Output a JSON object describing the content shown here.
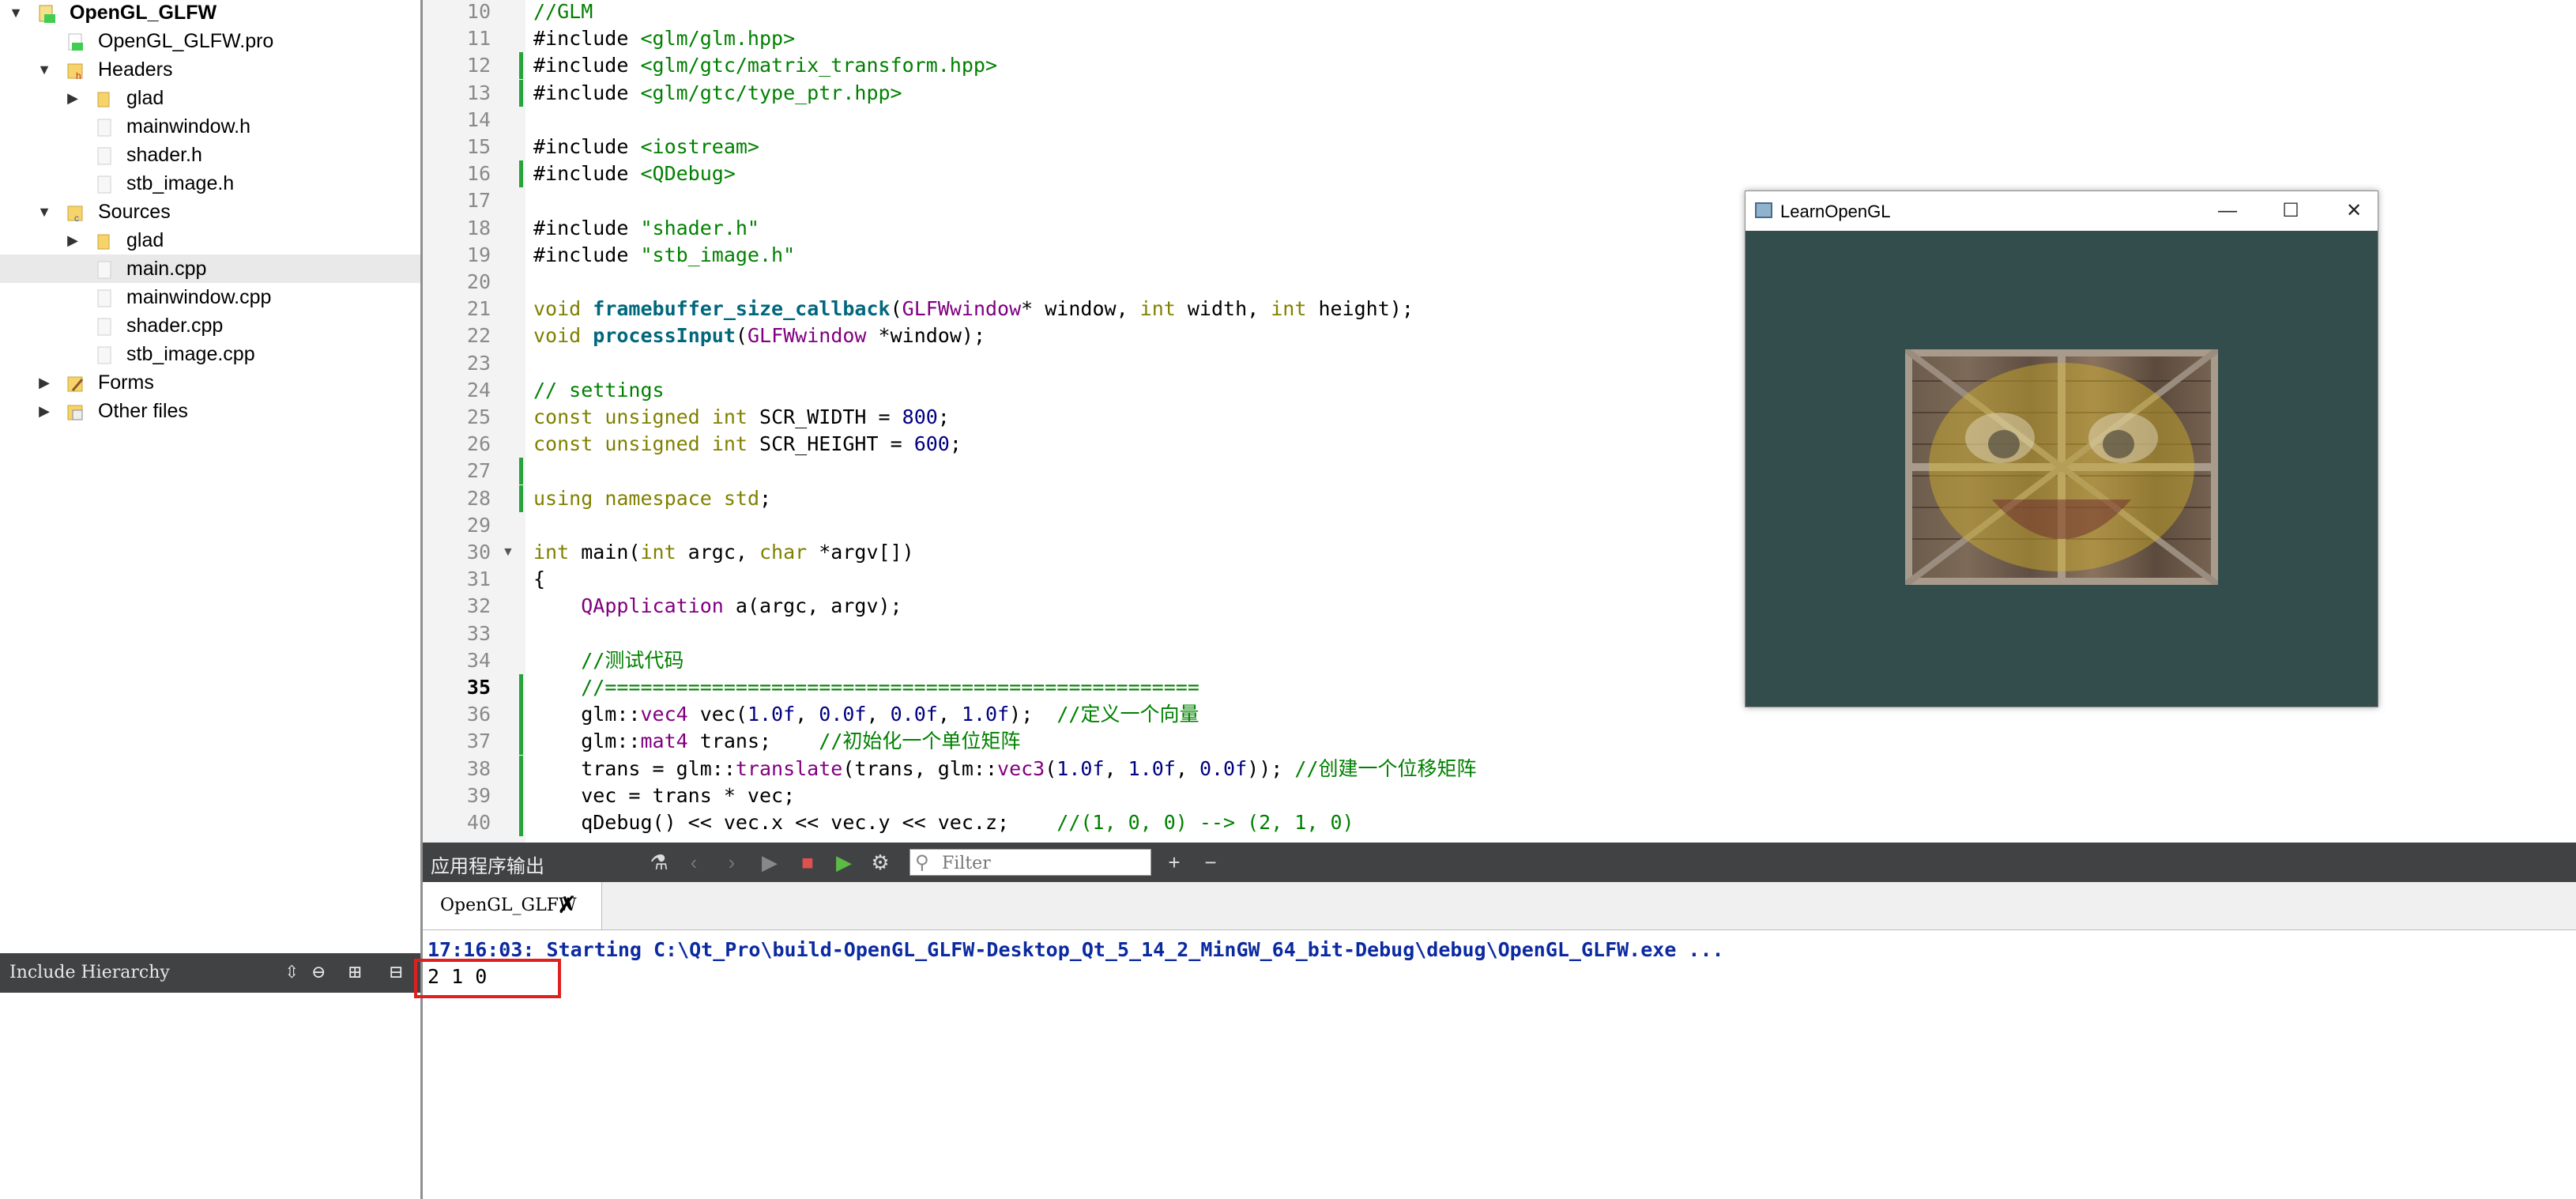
{
  "project_tree": {
    "items": [
      {
        "label": "OpenGL_GLFW",
        "arrow": "▼",
        "icon": "project-icon",
        "bold": true
      },
      {
        "label": "OpenGL_GLFW.pro",
        "arrow": "",
        "icon": "pro-file-icon"
      },
      {
        "label": "Headers",
        "arrow": "▼",
        "icon": "headers-folder-icon"
      },
      {
        "label": "glad",
        "arrow": "▶",
        "icon": "folder-icon"
      },
      {
        "label": "mainwindow.h",
        "arrow": "",
        "icon": "file-icon"
      },
      {
        "label": "shader.h",
        "arrow": "",
        "icon": "file-icon"
      },
      {
        "label": "stb_image.h",
        "arrow": "",
        "icon": "file-icon"
      },
      {
        "label": "Sources",
        "arrow": "▼",
        "icon": "sources-folder-icon"
      },
      {
        "label": "glad",
        "arrow": "▶",
        "icon": "folder-icon"
      },
      {
        "label": "main.cpp",
        "arrow": "",
        "icon": "file-icon",
        "selected": true
      },
      {
        "label": "mainwindow.cpp",
        "arrow": "",
        "icon": "file-icon"
      },
      {
        "label": "shader.cpp",
        "arrow": "",
        "icon": "file-icon"
      },
      {
        "label": "stb_image.cpp",
        "arrow": "",
        "icon": "file-icon"
      },
      {
        "label": "Forms",
        "arrow": "▶",
        "icon": "forms-folder-icon"
      },
      {
        "label": "Other files",
        "arrow": "▶",
        "icon": "other-files-icon"
      }
    ]
  },
  "include_hierarchy": {
    "label": "Include Hierarchy"
  },
  "editor": {
    "current_line": 35,
    "lines": [
      {
        "n": "10",
        "text": "//GLM"
      },
      {
        "n": "11",
        "text": "#include <glm/glm.hpp>"
      },
      {
        "n": "12",
        "text": "#include <glm/gtc/matrix_transform.hpp>"
      },
      {
        "n": "13",
        "text": "#include <glm/gtc/type_ptr.hpp>"
      },
      {
        "n": "14",
        "text": ""
      },
      {
        "n": "15",
        "text": "#include <iostream>"
      },
      {
        "n": "16",
        "text": "#include <QDebug>"
      },
      {
        "n": "17",
        "text": ""
      },
      {
        "n": "18",
        "text": "#include \"shader.h\""
      },
      {
        "n": "19",
        "text": "#include \"stb_image.h\""
      },
      {
        "n": "20",
        "text": ""
      },
      {
        "n": "21",
        "text": "void framebuffer_size_callback(GLFWwindow* window, int width, int height);"
      },
      {
        "n": "22",
        "text": "void processInput(GLFWwindow *window);"
      },
      {
        "n": "23",
        "text": ""
      },
      {
        "n": "24",
        "text": "// settings"
      },
      {
        "n": "25",
        "text": "const unsigned int SCR_WIDTH = 800;"
      },
      {
        "n": "26",
        "text": "const unsigned int SCR_HEIGHT = 600;"
      },
      {
        "n": "27",
        "text": ""
      },
      {
        "n": "28",
        "text": "using namespace std;"
      },
      {
        "n": "29",
        "text": ""
      },
      {
        "n": "30",
        "text": "int main(int argc, char *argv[])"
      },
      {
        "n": "31",
        "text": "{"
      },
      {
        "n": "32",
        "text": "    QApplication a(argc, argv);"
      },
      {
        "n": "33",
        "text": ""
      },
      {
        "n": "34",
        "text": "    //测试代码"
      },
      {
        "n": "35",
        "text": "    //=================================================="
      },
      {
        "n": "36",
        "text": "    glm::vec4 vec(1.0f, 0.0f, 0.0f, 1.0f);  //定义一个向量"
      },
      {
        "n": "37",
        "text": "    glm::mat4 trans;    //初始化一个单位矩阵"
      },
      {
        "n": "38",
        "text": "    trans = glm::translate(trans, glm::vec3(1.0f, 1.0f, 0.0f)); //创建一个位移矩阵"
      },
      {
        "n": "39",
        "text": "    vec = trans * vec;"
      },
      {
        "n": "40",
        "text": "    qDebug() << vec.x << vec.y << vec.z;    //(1, 0, 0) --> (2, 1, 0)"
      }
    ]
  },
  "gl_window": {
    "title": "LearnOpenGL",
    "minimize": "—",
    "maximize": "☐",
    "close": "✕",
    "clear_color": "#334d4d"
  },
  "output_pane": {
    "title": "应用程序输出",
    "filter_placeholder": "Filter",
    "tab_label": "OpenGL_GLFW",
    "start_line": "17:16:03: Starting C:\\Qt_Pro\\build-OpenGL_GLFW-Desktop_Qt_5_14_2_MinGW_64_bit-Debug\\debug\\OpenGL_GLFW.exe ...",
    "result_line": "2 1 0"
  },
  "colors": {
    "toolbar_bg": "#404244",
    "modified_marker": "#27a33c",
    "highlight_box": "#e02020",
    "start_text": "#0b2aa0"
  }
}
